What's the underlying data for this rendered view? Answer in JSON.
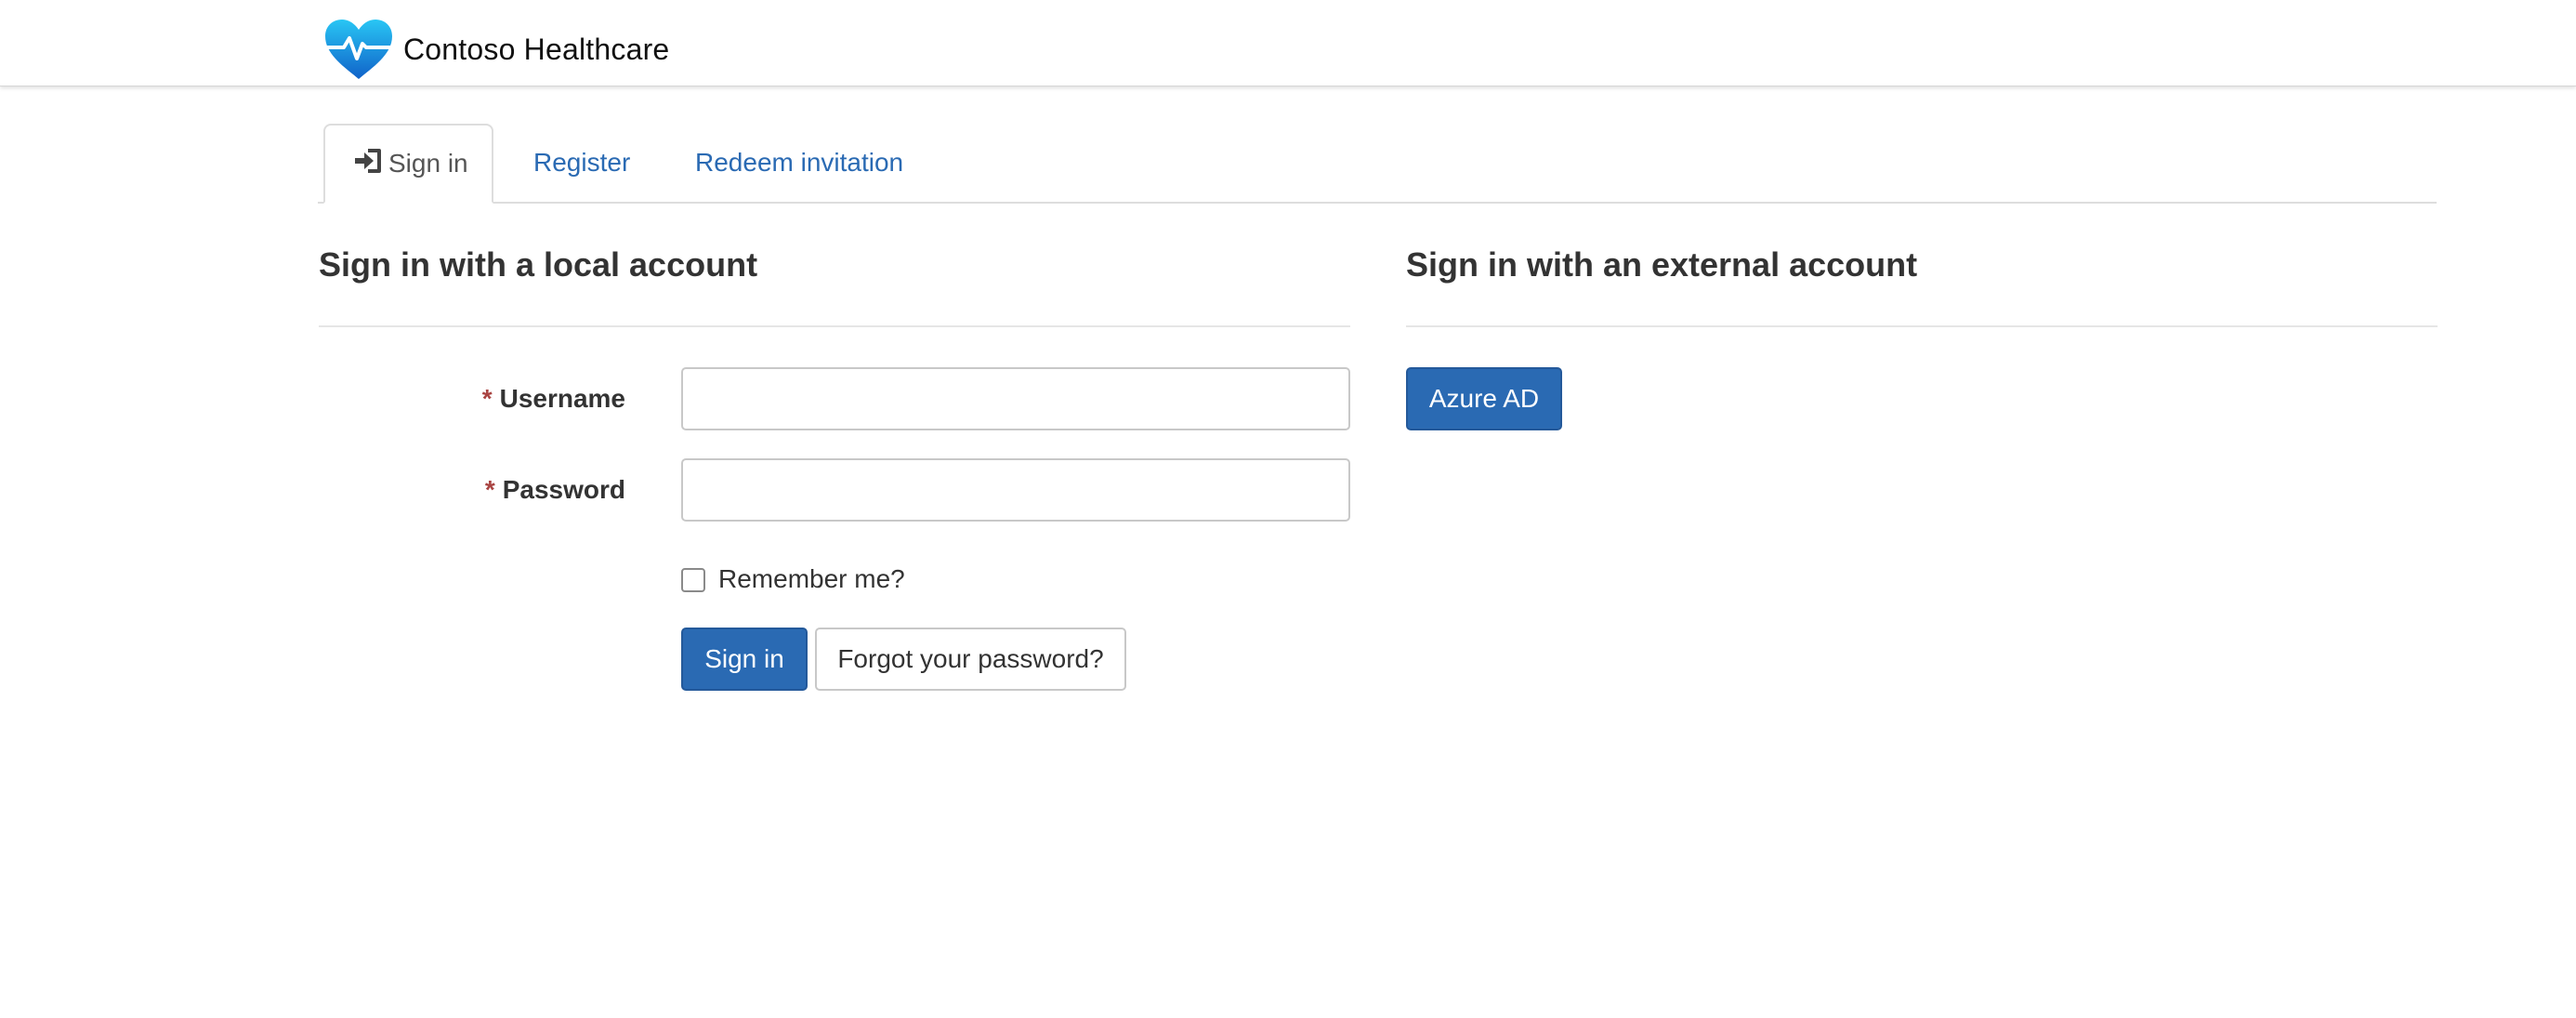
{
  "brand": {
    "name": "Contoso Healthcare",
    "logo_icon": "heart-pulse-icon"
  },
  "tabs": [
    {
      "label": "Sign in",
      "icon": "sign-in-icon",
      "active": true
    },
    {
      "label": "Register",
      "active": false
    },
    {
      "label": "Redeem invitation",
      "active": false
    }
  ],
  "local": {
    "title": "Sign in with a local account",
    "username_label": "Username",
    "username_value": "",
    "password_label": "Password",
    "password_value": "",
    "required_marker": "*",
    "remember_label": "Remember me?",
    "remember_checked": false,
    "signin_button": "Sign in",
    "forgot_button": "Forgot your password?"
  },
  "external": {
    "title": "Sign in with an external account",
    "providers": [
      {
        "label": "Azure AD"
      }
    ]
  },
  "colors": {
    "primary": "#2a6ab3",
    "link": "#2a6ab3",
    "required": "#a94442",
    "text": "#333333"
  }
}
